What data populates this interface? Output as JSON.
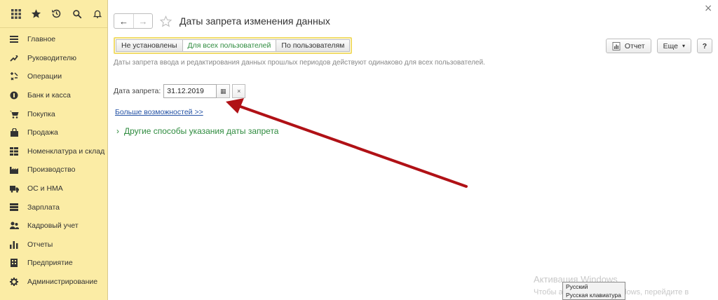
{
  "page": {
    "title": "Даты запрета изменения данных"
  },
  "sidebar": {
    "top_icons": [
      "apps-grid-icon",
      "star-icon",
      "history-icon",
      "search-icon",
      "bell-icon"
    ],
    "items": [
      {
        "label": "Главное",
        "icon": "hamburger-icon"
      },
      {
        "label": "Руководителю",
        "icon": "trend-icon"
      },
      {
        "label": "Операции",
        "icon": "operations-icon"
      },
      {
        "label": "Банк и касса",
        "icon": "coin-icon"
      },
      {
        "label": "Покупка",
        "icon": "cart-icon"
      },
      {
        "label": "Продажа",
        "icon": "bag-icon"
      },
      {
        "label": "Номенклатура и склад",
        "icon": "warehouse-icon"
      },
      {
        "label": "Производство",
        "icon": "factory-icon"
      },
      {
        "label": "ОС и НМА",
        "icon": "truck-icon"
      },
      {
        "label": "Зарплата",
        "icon": "salary-icon"
      },
      {
        "label": "Кадровый учет",
        "icon": "people-icon"
      },
      {
        "label": "Отчеты",
        "icon": "bar-chart-icon"
      },
      {
        "label": "Предприятие",
        "icon": "building-icon"
      },
      {
        "label": "Администрирование",
        "icon": "gear-icon"
      }
    ]
  },
  "nav": {
    "back": "←",
    "forward": "→"
  },
  "modes": {
    "not_set": "Не установлены",
    "all_users": "Для всех пользователей",
    "by_user": "По пользователям",
    "selected": "all_users"
  },
  "toolbar": {
    "report": "Отчет",
    "more": "Еще",
    "help": "?"
  },
  "description": "Даты запрета ввода и редактирования данных прошлых периодов действуют одинаково для всех пользователей.",
  "date_field": {
    "label": "Дата запрета:",
    "value": "31.12.2019",
    "calendar": "▦",
    "clear": "×"
  },
  "more_link": "Больше возможностей >>",
  "other_ways": {
    "chevron": "›",
    "label": "Другие способы указания даты запрета"
  },
  "close": "×",
  "watermark": {
    "line1": "Активация Windows",
    "line2": "Чтобы активировать Windows, перейдите в"
  },
  "language_popup": {
    "language": "Русский",
    "keyboard": "Русская клавиатура"
  },
  "colors": {
    "sidebar_bg": "#fbeca5",
    "accent_green": "#2e8b3e",
    "link_blue": "#2351a4",
    "arrow_red": "#b01116"
  }
}
